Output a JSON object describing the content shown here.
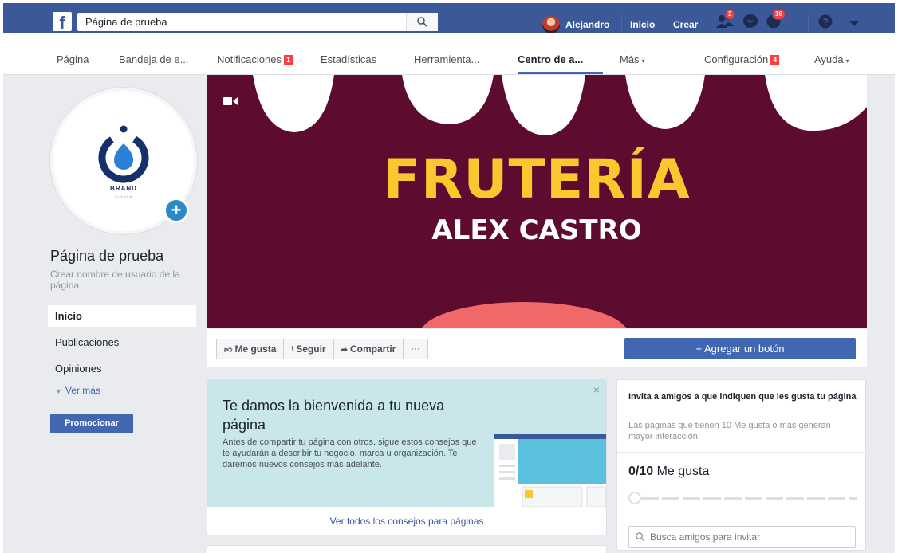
{
  "topbar": {
    "search_value": "Página de prueba",
    "user_name": "Alejandro",
    "home_label": "Inicio",
    "create_label": "Crear",
    "friend_badge": "2",
    "notif_badge": "16"
  },
  "page_nav": {
    "items": [
      "Página",
      "Bandeja de e...",
      "Notificaciones",
      "Estadísticas",
      "Herramienta...",
      "Centro de a...",
      "Más",
      "Configuración",
      "Ayuda"
    ],
    "notif_badge": "1",
    "config_badge": "4"
  },
  "left": {
    "brand_text": "BRAND",
    "brand_sub": "SLOGAN",
    "page_name": "Página de prueba",
    "username_link": "Crear nombre de usuario de la página",
    "nav": [
      "Inicio",
      "Publicaciones",
      "Opiniones"
    ],
    "see_more": "Ver más",
    "promote": "Promocionar"
  },
  "cover": {
    "title": "FRUTERÍA",
    "subtitle": "ALEX CASTRO",
    "bg_color": "#5e0b30",
    "title_color": "#f9c72e"
  },
  "actions": {
    "like": "Me gusta",
    "follow": "Seguir",
    "share": "Compartir",
    "more": "···",
    "add_button": "+ Agregar un botón"
  },
  "welcome": {
    "title": "Te damos la bienvenida a tu nueva página",
    "desc": "Antes de compartir tu página con otros, sigue estos consejos que te ayudarán a describir tu negocio, marca u organización. Te daremos nuevos consejos más adelante.",
    "link": "Ver todos los consejos para páginas",
    "close": "×"
  },
  "invite": {
    "title": "Invita a amigos a que indiquen que les gusta tu página",
    "desc": "Las páginas que tienen 10 Me gusta o más generan mayor interacción.",
    "count": "0/10",
    "count_label": " Me gusta",
    "progress": 0,
    "search_placeholder": "Busca amigos para invitar"
  }
}
